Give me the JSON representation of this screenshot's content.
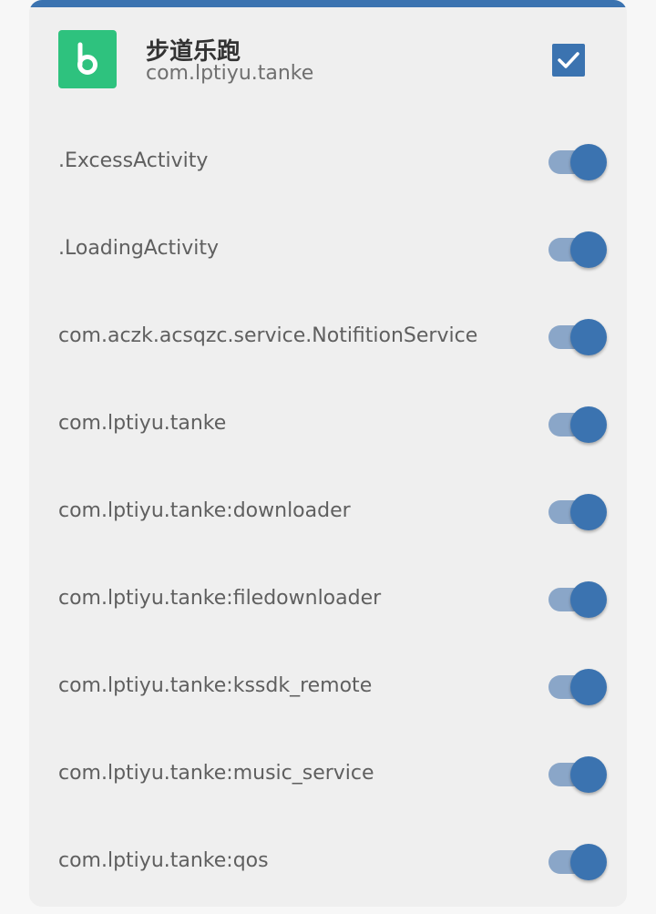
{
  "app": {
    "name": "步道乐跑",
    "package": "com.lptiyu.tanke",
    "icon": "b-logo-icon",
    "icon_color": "#2ec27e",
    "selected": true
  },
  "accent_color": "#3b73b0",
  "components": [
    {
      "name": ".ExcessActivity",
      "enabled": true
    },
    {
      "name": ".LoadingActivity",
      "enabled": true
    },
    {
      "name": "com.aczk.acsqzc.service.NotifitionService",
      "enabled": true
    },
    {
      "name": "com.lptiyu.tanke",
      "enabled": true
    },
    {
      "name": "com.lptiyu.tanke:downloader",
      "enabled": true
    },
    {
      "name": "com.lptiyu.tanke:filedownloader",
      "enabled": true
    },
    {
      "name": "com.lptiyu.tanke:kssdk_remote",
      "enabled": true
    },
    {
      "name": "com.lptiyu.tanke:music_service",
      "enabled": true
    },
    {
      "name": "com.lptiyu.tanke:qos",
      "enabled": true
    }
  ]
}
